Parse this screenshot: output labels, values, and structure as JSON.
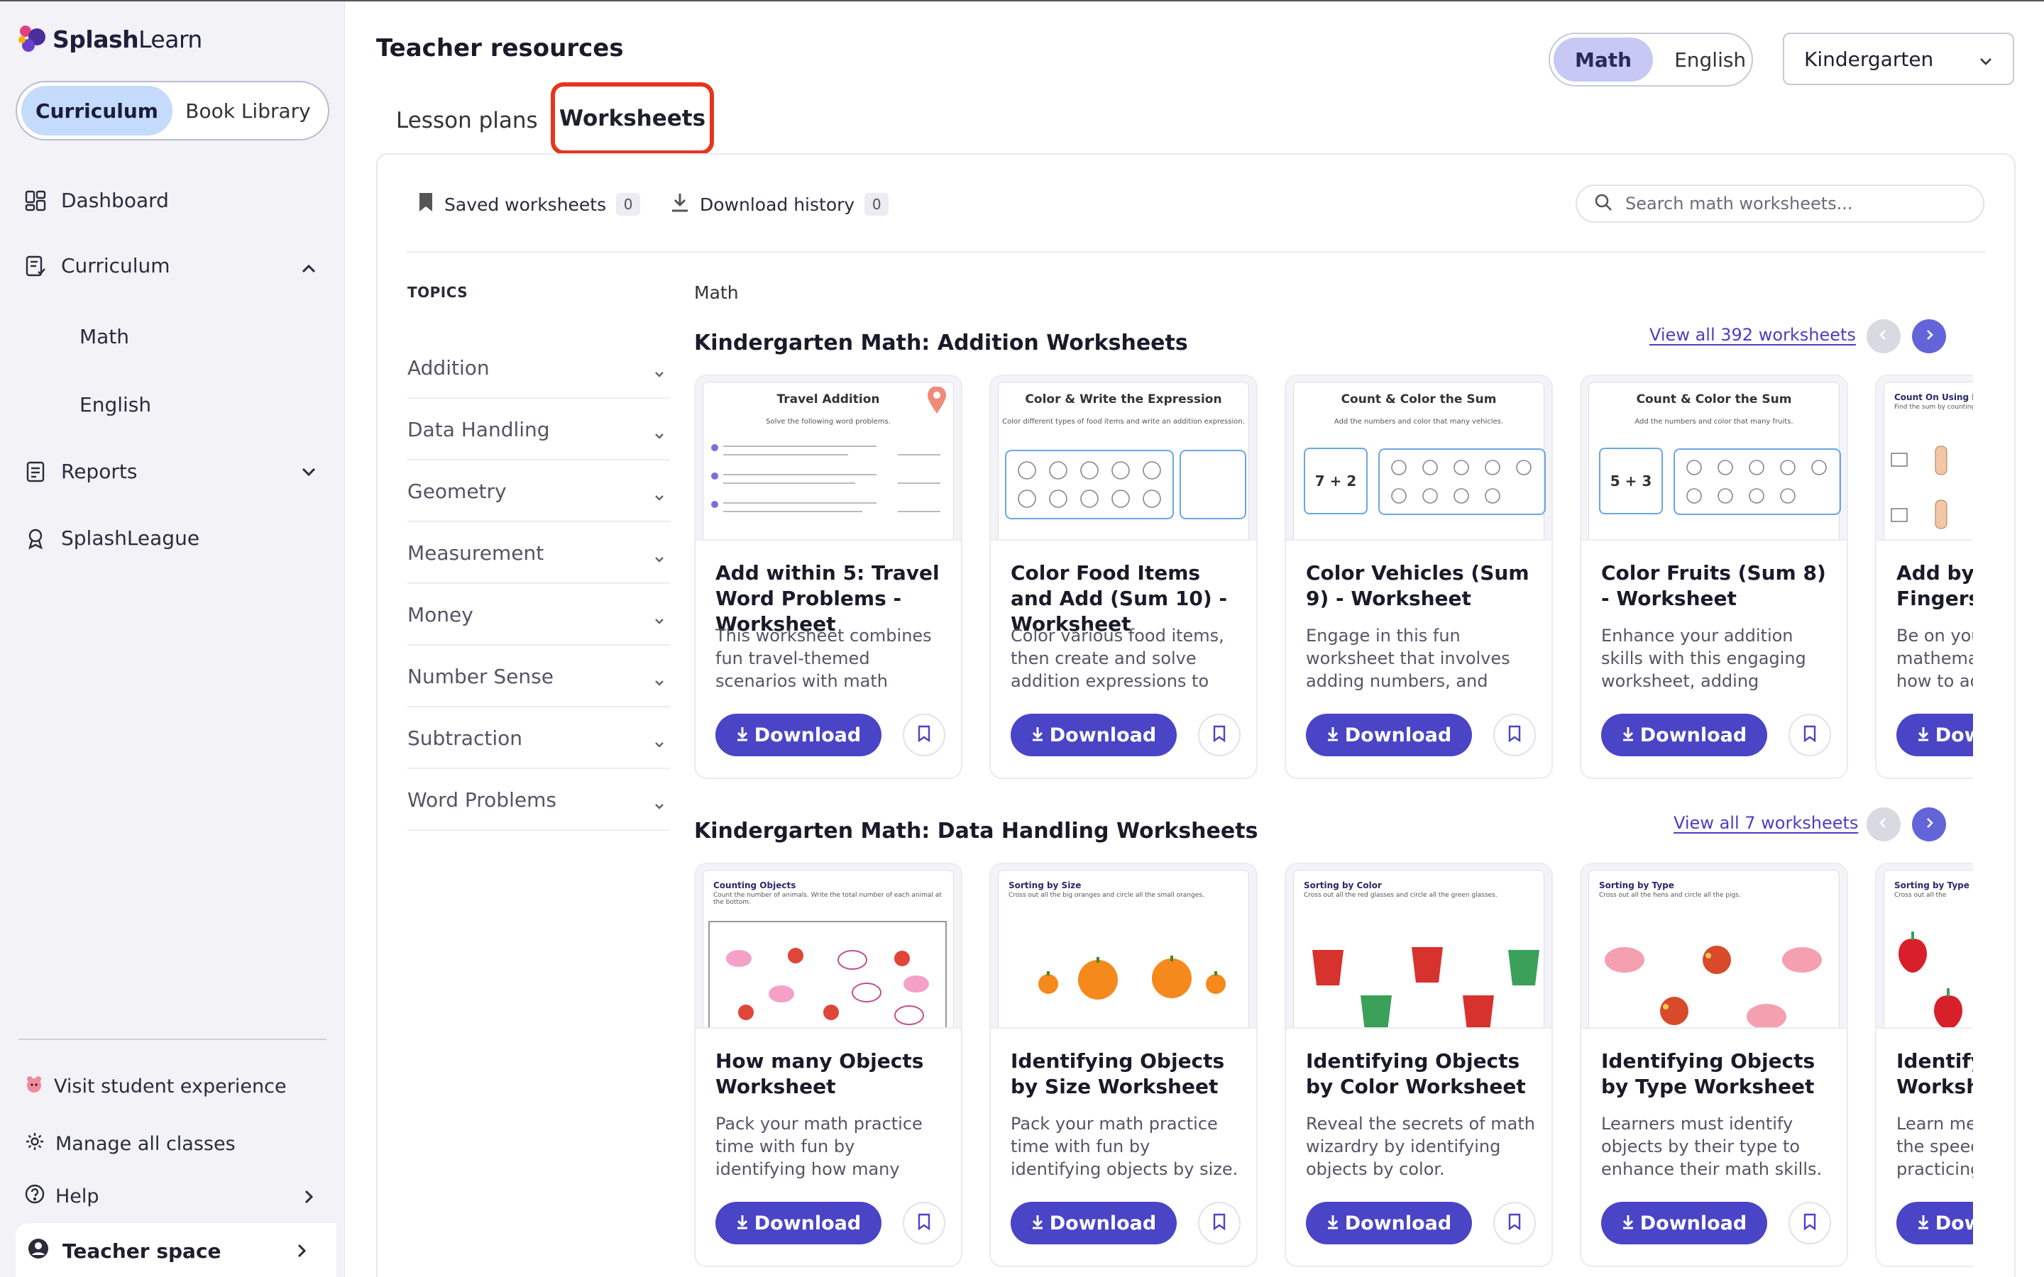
{
  "brand": {
    "name_bold": "Splash",
    "name_light": "Learn"
  },
  "sidebar": {
    "segment": [
      "Curriculum",
      "Book Library"
    ],
    "nav": {
      "dashboard": "Dashboard",
      "curriculum": "Curriculum",
      "math": "Math",
      "english": "English",
      "reports": "Reports",
      "splashleague": "SplashLeague"
    },
    "bottom": {
      "visit": "Visit student experience",
      "manage": "Manage all classes",
      "help": "Help",
      "teacher_space": "Teacher space"
    }
  },
  "header": {
    "title": "Teacher resources",
    "subjects": [
      "Math",
      "English"
    ],
    "active_subject": "Math",
    "grade": "Kindergarten"
  },
  "tabs": {
    "lesson_plans": "Lesson plans",
    "worksheets": "Worksheets"
  },
  "toolbar": {
    "saved_label": "Saved worksheets",
    "saved_count": "0",
    "history_label": "Download history",
    "history_count": "0",
    "search_placeholder": "Search math worksheets..."
  },
  "topics": {
    "heading": "TOPICS",
    "items": [
      "Addition",
      "Data Handling",
      "Geometry",
      "Measurement",
      "Money",
      "Number Sense",
      "Subtraction",
      "Word Problems"
    ]
  },
  "crumb": "Math",
  "sections": [
    {
      "title": "Kindergarten Math: Addition Worksheets",
      "view_all": "View all 392 worksheets",
      "cards": [
        {
          "thumb_title": "Travel Addition",
          "thumb_sub": "Solve the following word problems.",
          "title": "Add within 5: Travel Word Problems - Worksheet",
          "desc": "This worksheet combines fun travel-themed scenarios with math problems, requiring…"
        },
        {
          "thumb_title": "Color & Write the Expression",
          "thumb_sub": "Color different types of food items and write an addition expression.",
          "title": "Color Food Items and Add (Sum 10) - Worksheet",
          "desc": "Color various food items, then create and solve addition expressions to tot…"
        },
        {
          "thumb_title": "Count & Color the Sum",
          "thumb_sub": "Add the numbers and color that many vehicles.",
          "thumb_eq": "7 + 2",
          "title": "Color Vehicles (Sum 9) - Worksheet",
          "desc": "Engage in this fun worksheet that involves adding numbers, and coloring that…"
        },
        {
          "thumb_title": "Count & Color the Sum",
          "thumb_sub": "Add the numbers and color that many fruits.",
          "thumb_eq": "5 + 3",
          "title": "Color Fruits (Sum 8) - Worksheet",
          "desc": "Enhance your addition skills with this engaging worksheet, adding number…"
        },
        {
          "thumb_title": "Count On Using Fing",
          "thumb_sub": "Find the sum by counting",
          "title": "Add by Counting Fingers Worksheet",
          "desc": "Be on your way to mathematics by learning how to add by counting fingers."
        }
      ]
    },
    {
      "title": "Kindergarten Math: Data Handling Worksheets",
      "view_all": "View all 7 worksheets",
      "cards": [
        {
          "thumb_title": "Counting Objects",
          "thumb_sub": "Count the number of animals. Write the total number of each animal at the bottom.",
          "title": "How many Objects Worksheet",
          "desc": "Pack your math practice time with fun by identifying how many objects."
        },
        {
          "thumb_title": "Sorting by Size",
          "thumb_sub": "Cross out all the big oranges and circle all the small oranges.",
          "title": "Identifying Objects by Size Worksheet",
          "desc": "Pack your math practice time with fun by identifying objects by size."
        },
        {
          "thumb_title": "Sorting by Color",
          "thumb_sub": "Cross out all the red glasses and circle all the green glasses.",
          "title": "Identifying Objects by Color Worksheet",
          "desc": "Reveal the secrets of math wizardry by identifying objects by color."
        },
        {
          "thumb_title": "Sorting by Type",
          "thumb_sub": "Cross out all the hens and circle all the pigs.",
          "title": "Identifying Objects by Type Worksheet",
          "desc": "Learners must identify objects by their type to enhance their math skills."
        },
        {
          "thumb_title": "Sorting by Type",
          "thumb_sub": "Cross out all the",
          "title": "Identify Objects Worksheet",
          "desc": "Learn methods to increase the speed of learning while practicing math."
        }
      ]
    }
  ],
  "buttons": {
    "download": "Download"
  },
  "colors": {
    "accent": "#4a44c6",
    "tab_highlight": "#e8341c",
    "active_segment": "#c5dbfb"
  }
}
